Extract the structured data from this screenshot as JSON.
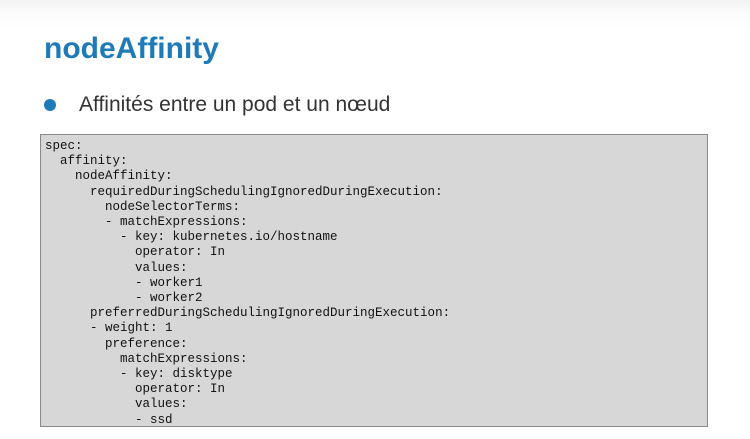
{
  "slide": {
    "title": "nodeAffinity",
    "bullet": "Affinités entre un pod et un nœud",
    "accent_color": "#1f7bb8"
  },
  "code": {
    "lines": [
      "spec:",
      "  affinity:",
      "    nodeAffinity:",
      "      requiredDuringSchedulingIgnoredDuringExecution:",
      "        nodeSelectorTerms:",
      "        - matchExpressions:",
      "          - key: kubernetes.io/hostname",
      "            operator: In",
      "            values:",
      "            - worker1",
      "            - worker2",
      "      preferredDuringSchedulingIgnoredDuringExecution:",
      "      - weight: 1",
      "        preference:",
      "          matchExpressions:",
      "          - key: disktype",
      "            operator: In",
      "            values:",
      "            - ssd"
    ]
  }
}
